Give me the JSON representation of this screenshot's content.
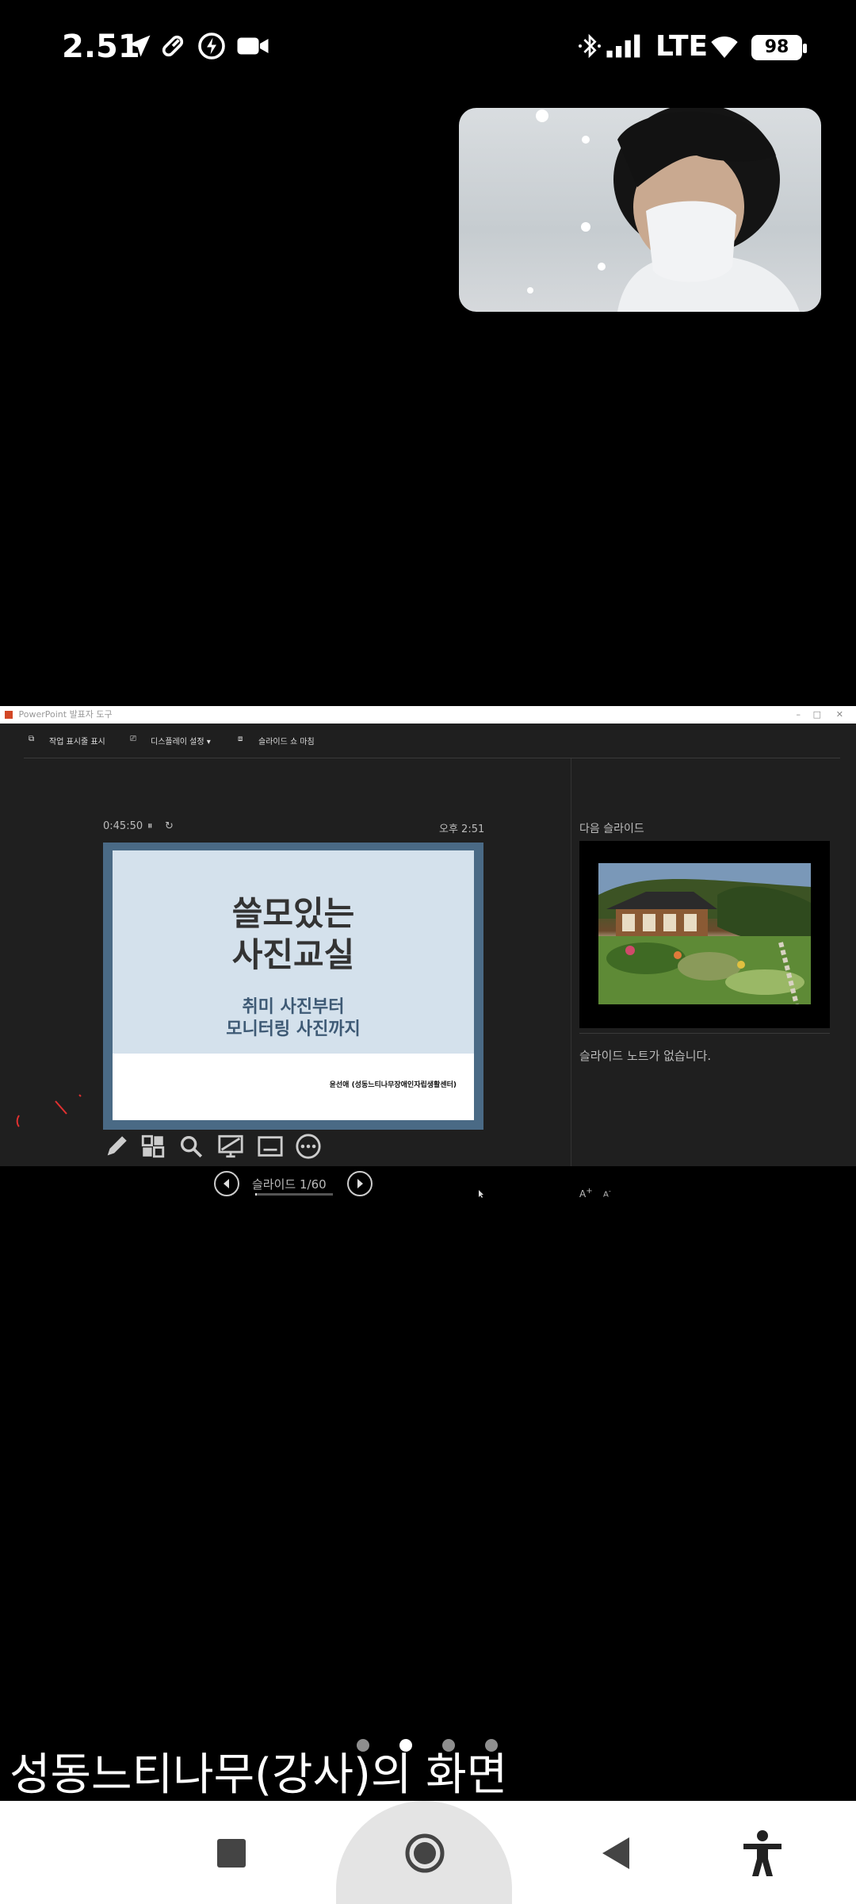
{
  "status_bar": {
    "time": "2.51",
    "network": "LTE",
    "battery": "98"
  },
  "ppt": {
    "window_title": "PowerPoint 발표자 도구",
    "toolbar": {
      "taskbar": "작업 표시줄 표시",
      "display": "디스플레이 설정 ▾",
      "slideshow": "슬라이드 쇼 마침"
    },
    "timer": "0:45:50",
    "clock": "오후 2:51",
    "slide": {
      "title_line1": "쓸모있는",
      "title_line2": "사진교실",
      "subtitle_line1": "취미 사진부터",
      "subtitle_line2": "모니터링 사진까지",
      "credit": "윤선애 (성동느티나무장애인자립생활센터)"
    },
    "slide_counter": "슬라이드 1/60",
    "next_slide_label": "다음 슬라이드",
    "notes": "슬라이드 노트가 없습니다."
  },
  "caption": "성동느티나무(강사)의 화면",
  "icons": {
    "pen": "pen-icon",
    "grid": "see-all-slides-icon",
    "zoom": "zoom-icon",
    "black_screen": "black-screen-icon",
    "subtitles": "subtitles-icon",
    "more": "more-options-icon"
  }
}
